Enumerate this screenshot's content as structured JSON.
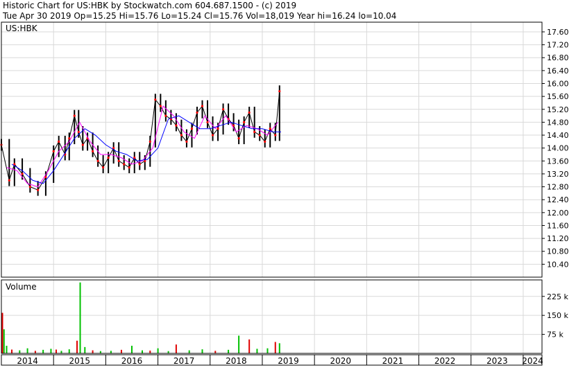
{
  "header": {
    "line1": "Historic Chart for US:HBK by Stockwatch.com 604.687.1500 - (c) 2019",
    "line2": "Tue Apr 30 2019   Op=15.25   Hi=15.76   Lo=15.24   Cl=15.76   Vol=18,019   Year hi=16.24   lo=10.04"
  },
  "colors": {
    "background": "#ffffff",
    "frame": "#000000",
    "grid": "#d9d9d9",
    "candle": "#000000",
    "ma_short": "#ff00ff",
    "ma_long": "#0000ff",
    "close_dot": "#ff0000",
    "volume_up": "#00c000",
    "volume_down": "#e00000"
  },
  "chart_data": [
    {
      "type": "candlestick",
      "title": "US:HBK",
      "y_ticks": [
        "17.60",
        "17.20",
        "16.80",
        "16.40",
        "16.00",
        "15.60",
        "15.20",
        "14.80",
        "14.40",
        "14.00",
        "13.60",
        "13.20",
        "12.80",
        "12.40",
        "12.00",
        "11.60",
        "11.20",
        "10.80",
        "10.40"
      ],
      "ylim": [
        10.0,
        17.9
      ],
      "x_labels": [
        "2014",
        "2015",
        "2016",
        "2017",
        "2018",
        "2019",
        "2020",
        "2021",
        "2022",
        "2023",
        "2024"
      ],
      "x_range": [
        2014.0,
        2024.36
      ],
      "grid": true,
      "series": [
        {
          "style": "price",
          "x": [
            2014.0,
            2014.15,
            2014.25,
            2014.4,
            2014.55,
            2014.7,
            2014.85,
            2015.0,
            2015.1,
            2015.22,
            2015.3,
            2015.4,
            2015.48,
            2015.56,
            2015.65,
            2015.75,
            2015.85,
            2015.95,
            2016.05,
            2016.15,
            2016.25,
            2016.35,
            2016.45,
            2016.55,
            2016.65,
            2016.75,
            2016.85,
            2016.95,
            2017.05,
            2017.15,
            2017.25,
            2017.35,
            2017.45,
            2017.55,
            2017.65,
            2017.75,
            2017.85,
            2017.95,
            2018.05,
            2018.15,
            2018.25,
            2018.35,
            2018.45,
            2018.55,
            2018.65,
            2018.75,
            2018.85,
            2018.95,
            2019.05,
            2019.15,
            2019.25,
            2019.33
          ],
          "values": [
            14.1,
            13.0,
            13.5,
            13.2,
            12.8,
            12.7,
            13.1,
            13.9,
            14.2,
            13.8,
            14.3,
            15.0,
            14.5,
            14.1,
            14.3,
            13.9,
            13.6,
            13.4,
            13.7,
            14.0,
            13.6,
            13.5,
            13.4,
            13.7,
            13.5,
            13.6,
            14.2,
            15.5,
            15.3,
            15.0,
            14.9,
            14.7,
            14.4,
            14.2,
            14.6,
            15.1,
            15.3,
            14.8,
            14.4,
            14.6,
            15.2,
            14.9,
            14.7,
            14.3,
            14.8,
            15.1,
            14.5,
            14.4,
            14.2,
            14.6,
            14.4,
            15.76
          ]
        },
        {
          "name": "",
          "style": "ma_short",
          "x": [
            2014.1,
            2014.3,
            2014.5,
            2014.7,
            2014.9,
            2015.1,
            2015.3,
            2015.5,
            2015.7,
            2015.9,
            2016.1,
            2016.3,
            2016.5,
            2016.7,
            2016.9,
            2017.1,
            2017.3,
            2017.5,
            2017.7,
            2017.9,
            2018.1,
            2018.3,
            2018.5,
            2018.7,
            2018.9,
            2019.1,
            2019.3
          ],
          "values": [
            13.4,
            13.3,
            12.9,
            12.8,
            13.3,
            13.9,
            14.2,
            14.8,
            14.2,
            13.8,
            13.8,
            13.7,
            13.5,
            13.6,
            14.0,
            15.3,
            15.0,
            14.5,
            14.3,
            15.0,
            14.6,
            15.0,
            14.5,
            14.7,
            14.6,
            14.4,
            14.8
          ]
        },
        {
          "name": "",
          "style": "ma_long",
          "x": [
            2014.2,
            2014.4,
            2014.6,
            2014.8,
            2015.0,
            2015.2,
            2015.4,
            2015.6,
            2015.8,
            2016.0,
            2016.2,
            2016.4,
            2016.6,
            2016.8,
            2017.0,
            2017.2,
            2017.4,
            2017.6,
            2017.8,
            2018.0,
            2018.2,
            2018.4,
            2018.6,
            2018.8,
            2019.0,
            2019.2,
            2019.36
          ],
          "values": [
            13.5,
            13.3,
            13.0,
            12.9,
            13.3,
            13.8,
            14.3,
            14.6,
            14.4,
            14.1,
            13.9,
            13.8,
            13.6,
            13.65,
            14.0,
            14.9,
            15.0,
            14.8,
            14.6,
            14.6,
            14.7,
            14.8,
            14.7,
            14.6,
            14.6,
            14.5,
            14.5
          ]
        }
      ]
    },
    {
      "type": "bar",
      "title": "Volume",
      "y_ticks": [
        "225 k",
        "150 k",
        "75 k"
      ],
      "y_tick_values": [
        225000,
        150000,
        75000
      ],
      "ylim": [
        0,
        290000
      ],
      "x_range": [
        2014.0,
        2024.36
      ],
      "series": [
        {
          "name": "",
          "x": [
            2014.02,
            2014.05,
            2014.1,
            2014.2,
            2014.35,
            2014.5,
            2014.65,
            2014.8,
            2014.95,
            2015.05,
            2015.15,
            2015.3,
            2015.45,
            2015.51,
            2015.6,
            2015.75,
            2015.9,
            2016.1,
            2016.3,
            2016.5,
            2016.7,
            2016.85,
            2017.0,
            2017.2,
            2017.35,
            2017.6,
            2017.85,
            2018.1,
            2018.35,
            2018.55,
            2018.75,
            2018.9,
            2019.1,
            2019.25,
            2019.33
          ],
          "values": [
            160000,
            95000,
            30000,
            15000,
            12000,
            20000,
            10000,
            14000,
            18000,
            15000,
            10000,
            16000,
            50000,
            280000,
            25000,
            12000,
            9000,
            10000,
            14000,
            30000,
            12000,
            11000,
            20000,
            9000,
            35000,
            12000,
            16000,
            10000,
            14000,
            70000,
            55000,
            18000,
            20000,
            45000,
            40000
          ]
        }
      ]
    }
  ]
}
